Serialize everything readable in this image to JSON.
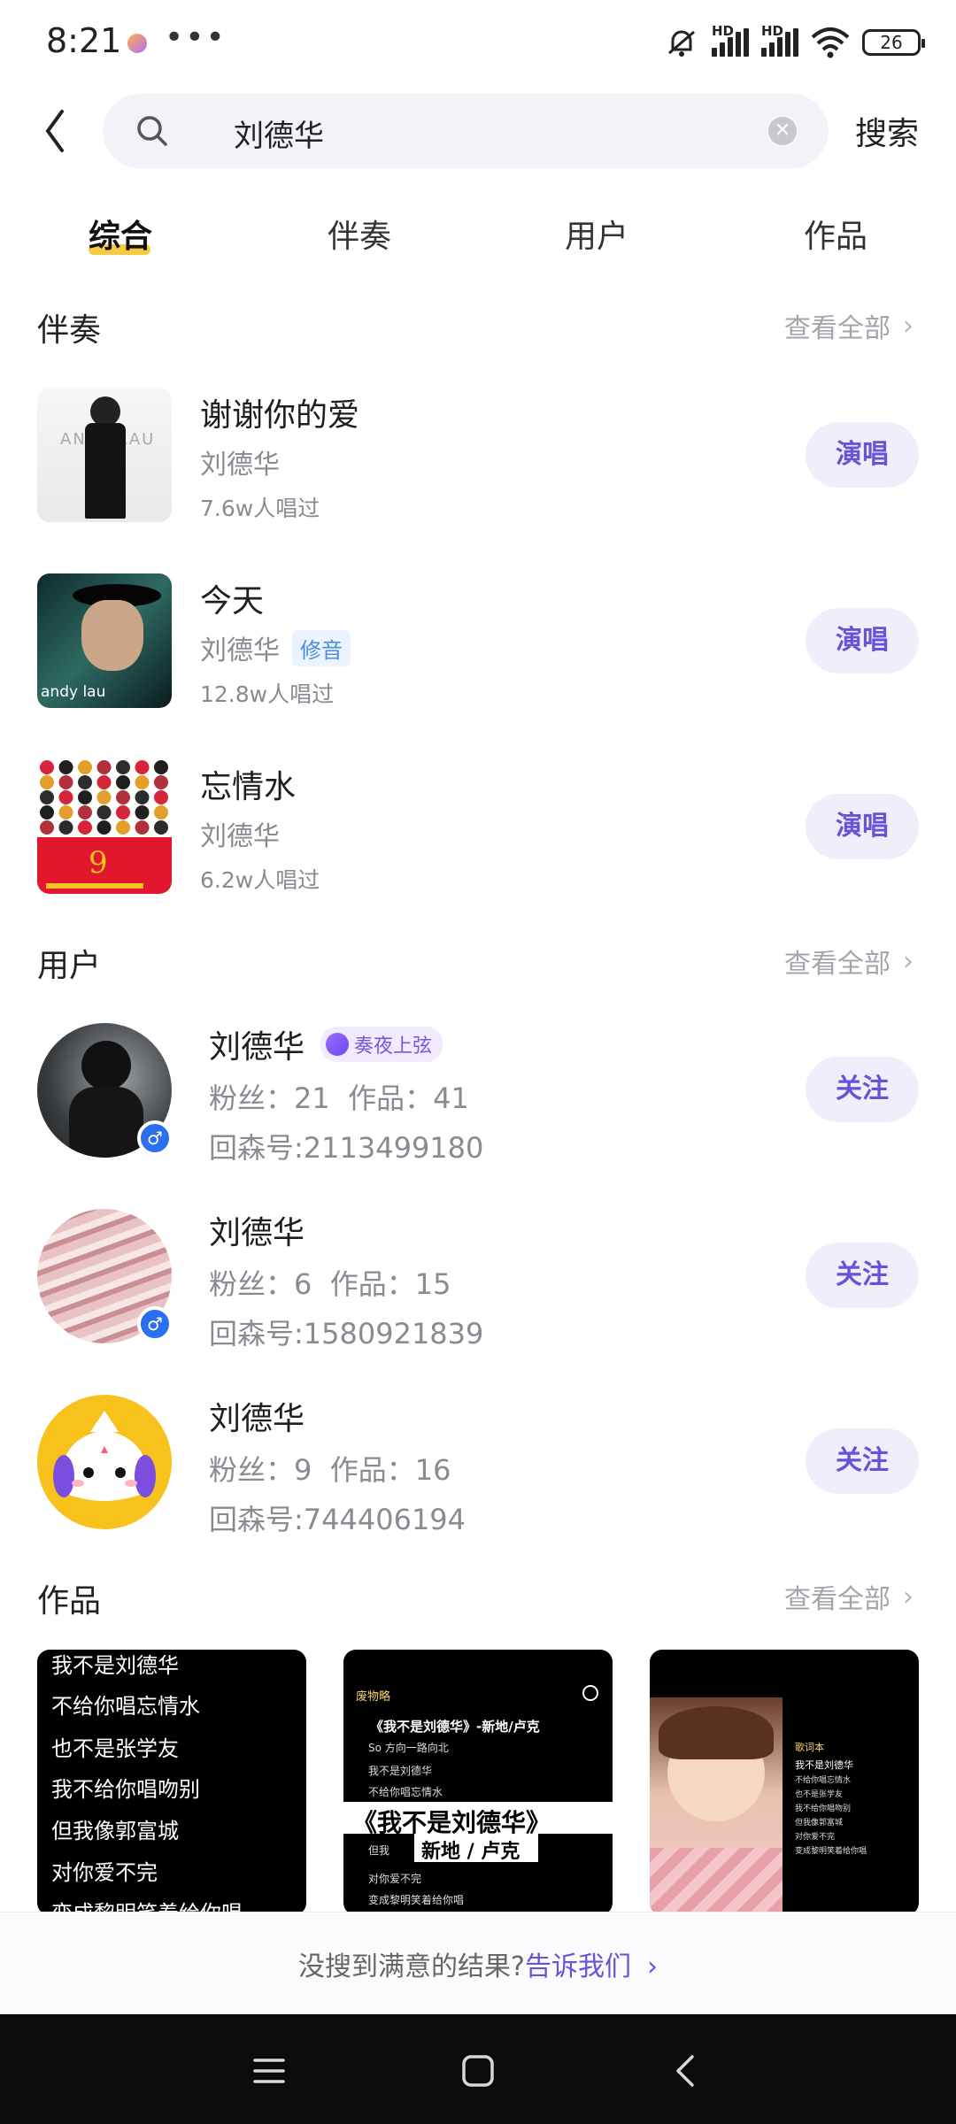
{
  "status_bar": {
    "time": "8:21",
    "dots": "•••",
    "battery": "26",
    "hd1": "HD",
    "hd2": "HD"
  },
  "search": {
    "query": "刘德华",
    "button": "搜索"
  },
  "tabs": [
    {
      "label": "综合",
      "active": true
    },
    {
      "label": "伴奏"
    },
    {
      "label": "用户"
    },
    {
      "label": "作品"
    }
  ],
  "sections": {
    "accompaniment": {
      "title": "伴奏",
      "see_all": "查看全部"
    },
    "users": {
      "title": "用户",
      "see_all": "查看全部"
    },
    "works": {
      "title": "作品",
      "see_all": "查看全部"
    }
  },
  "accompaniments": [
    {
      "title": "谢谢你的爱",
      "artist": "刘德华",
      "count": "7.6w人唱过",
      "action": "演唱",
      "tag": ""
    },
    {
      "title": "今天",
      "artist": "刘德华",
      "count": "12.8w人唱过",
      "action": "演唱",
      "tag": "修音"
    },
    {
      "title": "忘情水",
      "artist": "刘德华",
      "count": "6.2w人唱过",
      "action": "演唱",
      "tag": ""
    }
  ],
  "cover_text": {
    "c1": "ANDY LAU",
    "c2": "andy lau"
  },
  "users": [
    {
      "name": "刘德华",
      "badge": "奏夜上弦",
      "stats": "粉丝：21  作品：41",
      "id": "回森号:2113499180",
      "action": "关注"
    },
    {
      "name": "刘德华",
      "stats": "粉丝：6  作品：15",
      "id": "回森号:1580921839",
      "action": "关注"
    },
    {
      "name": "刘德华",
      "stats": "粉丝：9  作品：16",
      "id": "回森号:744406194",
      "action": "关注"
    }
  ],
  "works": {
    "w1_lines": [
      "我不是刘德华",
      "不给你唱忘情水",
      "也不是张学友",
      "我不给你唱吻别",
      "但我像郭富城",
      "对你爱不完",
      "变成黎明笑着给你唱"
    ],
    "w2_header": "废物略",
    "w2_title": "《我不是刘德华》-新地/卢克",
    "w2_lines": [
      "So 方向一路向北",
      "我不是刘德华",
      "不给你唱忘情水",
      "但我",
      "对你爱不完",
      "变成黎明笑着给你唱"
    ],
    "w2_banner": "《我不是刘德华》",
    "w2_sub": "新地 / 卢克",
    "w3_header": "歌词本",
    "w3_lines": [
      "我不是刘德华",
      "不给你唱忘情水",
      "也不是张学友",
      "我不给你唱吻别",
      "但我像郭富城",
      "对你爱不完",
      "变成黎明笑着给你唱"
    ]
  },
  "feedback": {
    "text": "没搜到满意的结果?",
    "link": "告诉我们"
  }
}
